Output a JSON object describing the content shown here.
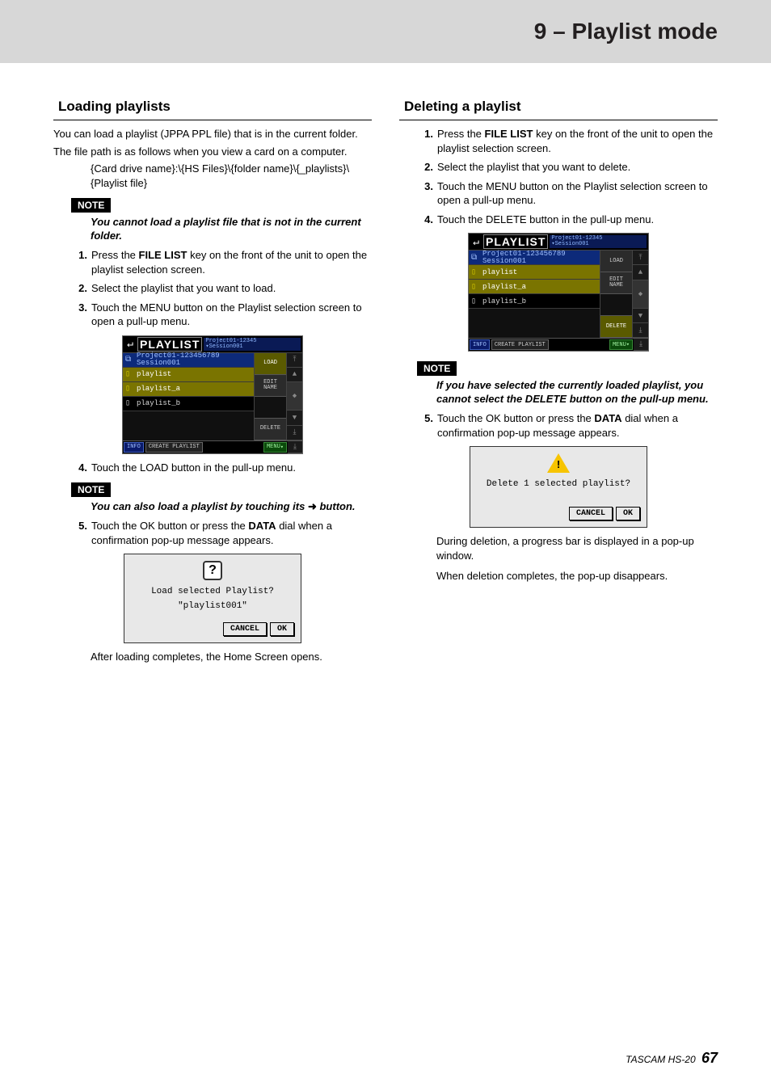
{
  "chapter": "9 – Playlist mode",
  "left": {
    "heading": "Loading playlists",
    "p1": "You can load a playlist (JPPA PPL file) that is in the current folder.",
    "p2": "The file path is as follows when you view a card on a computer.",
    "path": "{Card drive name}:\\{HS Files}\\{folder name}\\{_playlists}\\{Playlist file}",
    "noteLabel": "NOTE",
    "note1": "You cannot load a playlist file that is not in the current folder.",
    "steps_a": [
      {
        "n": "1",
        "pre": "Press the ",
        "b": "FILE LIST",
        "post": " key on the front of the unit to open the playlist selection screen."
      },
      {
        "n": "2",
        "pre": "Select the playlist that you want to load.",
        "b": "",
        "post": ""
      },
      {
        "n": "3",
        "pre": "Touch the MENU button on the Playlist selection screen to open a pull-up menu.",
        "b": "",
        "post": ""
      }
    ],
    "step4": "Touch the LOAD button in the pull-up menu.",
    "note2_pre": "You can also load a playlist by touching its ",
    "note2_post": " button.",
    "step5_pre": "Touch the OK button or press the ",
    "step5_b": "DATA",
    "step5_post": " dial when a confirmation pop-up message appears.",
    "dialog": {
      "text": "Load selected Playlist?",
      "sub": "\"playlist001\"",
      "cancel": "CANCEL",
      "ok": "OK"
    },
    "after": "After loading completes, the Home Screen opens."
  },
  "right": {
    "heading": "Deleting a playlist",
    "steps_a": [
      {
        "n": "1",
        "pre": "Press the ",
        "b": "FILE LIST",
        "post": " key on the front of the unit to open the playlist selection screen."
      },
      {
        "n": "2",
        "pre": "Select the playlist that you want to delete.",
        "b": "",
        "post": ""
      },
      {
        "n": "3",
        "pre": "Touch the MENU button on the Playlist selection screen to open a pull-up menu.",
        "b": "",
        "post": ""
      },
      {
        "n": "4",
        "pre": "Touch the DELETE button in the pull-up menu.",
        "b": "",
        "post": ""
      }
    ],
    "noteLabel": "NOTE",
    "note1": "If you have selected the currently loaded playlist, you cannot select the DELETE button on the pull-up menu.",
    "step5_pre": "Touch the OK button or press the ",
    "step5_b": "DATA",
    "step5_post": " dial when a confirmation pop-up message appears.",
    "dialog": {
      "text": "Delete 1 selected playlist?",
      "cancel": "CANCEL",
      "ok": "OK"
    },
    "p_after1": "During deletion, a progress bar is displayed in a pop-up window.",
    "p_after2": "When deletion completes, the pop-up disappears."
  },
  "lcd": {
    "title": "PLAYLIST",
    "path1": "Project01-12345",
    "path2": "Session001",
    "session": "Project01-123456789",
    "sessionSub": "Session001",
    "items": [
      "playlist",
      "playlist_a",
      "playlist_b"
    ],
    "side": {
      "load": "LOAD",
      "edit": "EDIT NAME",
      "delete": "DELETE"
    },
    "footer": {
      "info": "INFO",
      "create": "CREATE PLAYLIST",
      "menu": "MENU"
    }
  },
  "footer": {
    "product": "TASCAM HS-20",
    "page": "67"
  }
}
